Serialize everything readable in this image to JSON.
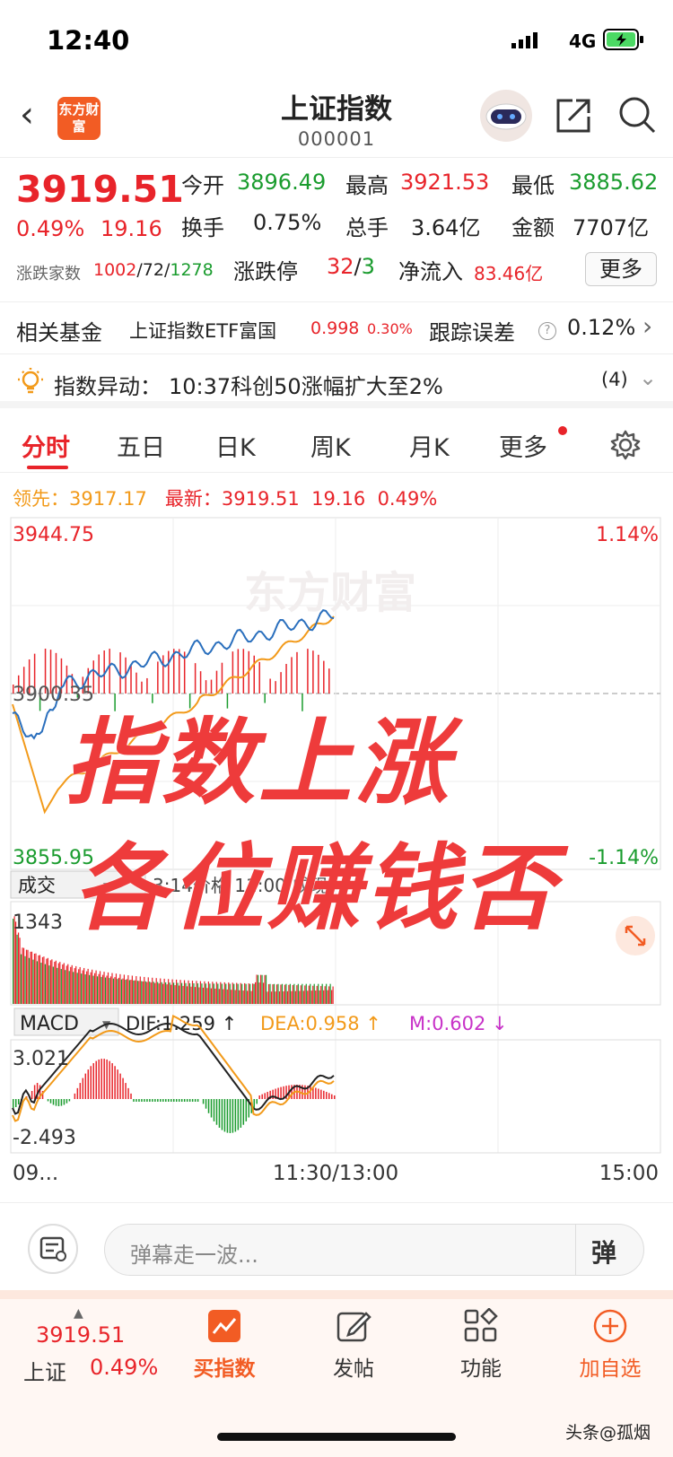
{
  "status_bar": {
    "time": "12:40",
    "network": "4G"
  },
  "header": {
    "logo_text": "东方财富",
    "title": "上证指数",
    "code": "000001"
  },
  "quote": {
    "price": "3919.51",
    "pct": "0.49%",
    "change": "19.16",
    "open_label": "今开",
    "open": "3896.49",
    "high_label": "最高",
    "high": "3921.53",
    "low_label": "最低",
    "low": "3885.62",
    "turnover_label": "换手",
    "turnover": "0.75%",
    "vol_label": "总手",
    "vol": "3.64亿",
    "amount_label": "金额",
    "amount": "7707亿",
    "breadth_label": "涨跌家数",
    "breadth_up": "1002",
    "breadth_flat": "72",
    "breadth_down": "1278",
    "limit_label": "涨跌停",
    "limit_up": "32",
    "limit_down": "3",
    "inflow_label": "净流入",
    "inflow": "83.46亿",
    "more_label": "更多"
  },
  "fund": {
    "label": "相关基金",
    "name": "上证指数ETF富国",
    "price": "0.998",
    "pct": "0.30%",
    "error_label": "跟踪误差",
    "error": "0.12%"
  },
  "alert": {
    "label": "指数异动：",
    "text": "10:37科创50涨幅扩大至2%",
    "count": "(4)"
  },
  "tabs": [
    "分时",
    "五日",
    "日K",
    "周K",
    "月K",
    "更多"
  ],
  "lead": {
    "lead_label": "领先：",
    "lead": "3917.17",
    "latest_label": "最新：",
    "latest": "3919.51",
    "change": "19.16",
    "pct": "0.49%"
  },
  "chart": {
    "top_price": "3944.75",
    "top_pct": "1.14%",
    "mid_price": "3900.35",
    "bottom_price": "3855.95",
    "bottom_pct": "-1.14%",
    "watermark": "东方财富",
    "vol_tab": "成交",
    "vol_info": "3:14价格  11:00 成现",
    "vol_max": "1343",
    "macd_label": "MACD",
    "dif": "DIF:1.259 ↑",
    "dea": "DEA:0.958 ↑",
    "m": "M:0.602 ↓",
    "macd_top": "3.021",
    "macd_bottom": "-2.493",
    "t_start": "09...",
    "t_mid": "11:30/13:00",
    "t_end": "15:00",
    "colors": {
      "price_line": "#2a6fbd",
      "avg_line": "#f29a1a",
      "up": "#e8242a",
      "down": "#1a9c2e"
    }
  },
  "overlay": {
    "line1": "指数上涨",
    "line2": "各位赚钱否"
  },
  "comment": {
    "placeholder": "弹幕走一波...",
    "danmu": "弹"
  },
  "nav": {
    "index_price": "3919.51",
    "index_name": "上证",
    "index_pct": "0.49%",
    "items": [
      "买指数",
      "发帖",
      "功能",
      "加自选"
    ]
  },
  "watermark_footer": "头条@孤烟"
}
